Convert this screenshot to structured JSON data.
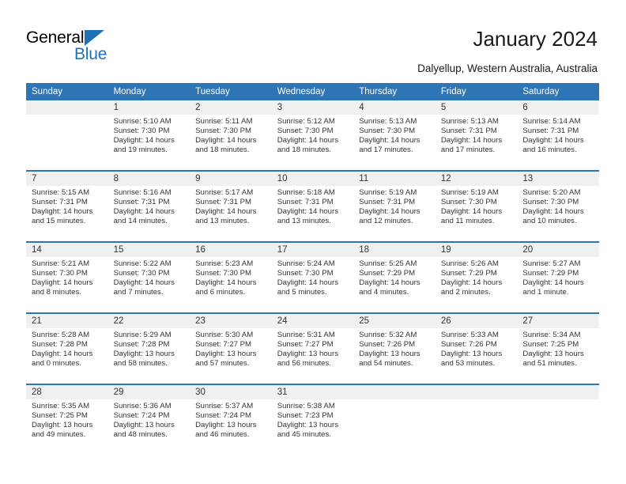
{
  "brand": {
    "name_part1": "General",
    "name_part2": "Blue",
    "triangle_color": "#1f71b8",
    "blue_color": "#1f71b8"
  },
  "header": {
    "title": "January 2024",
    "subtitle": "Dalyellup, Western Australia, Australia",
    "header_bg": "#2e75b6",
    "daynum_bg": "#f0f0f0"
  },
  "weekday_headers": [
    "Sunday",
    "Monday",
    "Tuesday",
    "Wednesday",
    "Thursday",
    "Friday",
    "Saturday"
  ],
  "weeks": [
    [
      {
        "day": "",
        "sunrise": "",
        "sunset": "",
        "daylight_line1": "",
        "daylight_line2": "",
        "empty": true
      },
      {
        "day": "1",
        "sunrise": "Sunrise: 5:10 AM",
        "sunset": "Sunset: 7:30 PM",
        "daylight_line1": "Daylight: 14 hours",
        "daylight_line2": "and 19 minutes.",
        "empty": false
      },
      {
        "day": "2",
        "sunrise": "Sunrise: 5:11 AM",
        "sunset": "Sunset: 7:30 PM",
        "daylight_line1": "Daylight: 14 hours",
        "daylight_line2": "and 18 minutes.",
        "empty": false
      },
      {
        "day": "3",
        "sunrise": "Sunrise: 5:12 AM",
        "sunset": "Sunset: 7:30 PM",
        "daylight_line1": "Daylight: 14 hours",
        "daylight_line2": "and 18 minutes.",
        "empty": false
      },
      {
        "day": "4",
        "sunrise": "Sunrise: 5:13 AM",
        "sunset": "Sunset: 7:30 PM",
        "daylight_line1": "Daylight: 14 hours",
        "daylight_line2": "and 17 minutes.",
        "empty": false
      },
      {
        "day": "5",
        "sunrise": "Sunrise: 5:13 AM",
        "sunset": "Sunset: 7:31 PM",
        "daylight_line1": "Daylight: 14 hours",
        "daylight_line2": "and 17 minutes.",
        "empty": false
      },
      {
        "day": "6",
        "sunrise": "Sunrise: 5:14 AM",
        "sunset": "Sunset: 7:31 PM",
        "daylight_line1": "Daylight: 14 hours",
        "daylight_line2": "and 16 minutes.",
        "empty": false
      }
    ],
    [
      {
        "day": "7",
        "sunrise": "Sunrise: 5:15 AM",
        "sunset": "Sunset: 7:31 PM",
        "daylight_line1": "Daylight: 14 hours",
        "daylight_line2": "and 15 minutes.",
        "empty": false
      },
      {
        "day": "8",
        "sunrise": "Sunrise: 5:16 AM",
        "sunset": "Sunset: 7:31 PM",
        "daylight_line1": "Daylight: 14 hours",
        "daylight_line2": "and 14 minutes.",
        "empty": false
      },
      {
        "day": "9",
        "sunrise": "Sunrise: 5:17 AM",
        "sunset": "Sunset: 7:31 PM",
        "daylight_line1": "Daylight: 14 hours",
        "daylight_line2": "and 13 minutes.",
        "empty": false
      },
      {
        "day": "10",
        "sunrise": "Sunrise: 5:18 AM",
        "sunset": "Sunset: 7:31 PM",
        "daylight_line1": "Daylight: 14 hours",
        "daylight_line2": "and 13 minutes.",
        "empty": false
      },
      {
        "day": "11",
        "sunrise": "Sunrise: 5:19 AM",
        "sunset": "Sunset: 7:31 PM",
        "daylight_line1": "Daylight: 14 hours",
        "daylight_line2": "and 12 minutes.",
        "empty": false
      },
      {
        "day": "12",
        "sunrise": "Sunrise: 5:19 AM",
        "sunset": "Sunset: 7:30 PM",
        "daylight_line1": "Daylight: 14 hours",
        "daylight_line2": "and 11 minutes.",
        "empty": false
      },
      {
        "day": "13",
        "sunrise": "Sunrise: 5:20 AM",
        "sunset": "Sunset: 7:30 PM",
        "daylight_line1": "Daylight: 14 hours",
        "daylight_line2": "and 10 minutes.",
        "empty": false
      }
    ],
    [
      {
        "day": "14",
        "sunrise": "Sunrise: 5:21 AM",
        "sunset": "Sunset: 7:30 PM",
        "daylight_line1": "Daylight: 14 hours",
        "daylight_line2": "and 8 minutes.",
        "empty": false
      },
      {
        "day": "15",
        "sunrise": "Sunrise: 5:22 AM",
        "sunset": "Sunset: 7:30 PM",
        "daylight_line1": "Daylight: 14 hours",
        "daylight_line2": "and 7 minutes.",
        "empty": false
      },
      {
        "day": "16",
        "sunrise": "Sunrise: 5:23 AM",
        "sunset": "Sunset: 7:30 PM",
        "daylight_line1": "Daylight: 14 hours",
        "daylight_line2": "and 6 minutes.",
        "empty": false
      },
      {
        "day": "17",
        "sunrise": "Sunrise: 5:24 AM",
        "sunset": "Sunset: 7:30 PM",
        "daylight_line1": "Daylight: 14 hours",
        "daylight_line2": "and 5 minutes.",
        "empty": false
      },
      {
        "day": "18",
        "sunrise": "Sunrise: 5:25 AM",
        "sunset": "Sunset: 7:29 PM",
        "daylight_line1": "Daylight: 14 hours",
        "daylight_line2": "and 4 minutes.",
        "empty": false
      },
      {
        "day": "19",
        "sunrise": "Sunrise: 5:26 AM",
        "sunset": "Sunset: 7:29 PM",
        "daylight_line1": "Daylight: 14 hours",
        "daylight_line2": "and 2 minutes.",
        "empty": false
      },
      {
        "day": "20",
        "sunrise": "Sunrise: 5:27 AM",
        "sunset": "Sunset: 7:29 PM",
        "daylight_line1": "Daylight: 14 hours",
        "daylight_line2": "and 1 minute.",
        "empty": false
      }
    ],
    [
      {
        "day": "21",
        "sunrise": "Sunrise: 5:28 AM",
        "sunset": "Sunset: 7:28 PM",
        "daylight_line1": "Daylight: 14 hours",
        "daylight_line2": "and 0 minutes.",
        "empty": false
      },
      {
        "day": "22",
        "sunrise": "Sunrise: 5:29 AM",
        "sunset": "Sunset: 7:28 PM",
        "daylight_line1": "Daylight: 13 hours",
        "daylight_line2": "and 58 minutes.",
        "empty": false
      },
      {
        "day": "23",
        "sunrise": "Sunrise: 5:30 AM",
        "sunset": "Sunset: 7:27 PM",
        "daylight_line1": "Daylight: 13 hours",
        "daylight_line2": "and 57 minutes.",
        "empty": false
      },
      {
        "day": "24",
        "sunrise": "Sunrise: 5:31 AM",
        "sunset": "Sunset: 7:27 PM",
        "daylight_line1": "Daylight: 13 hours",
        "daylight_line2": "and 56 minutes.",
        "empty": false
      },
      {
        "day": "25",
        "sunrise": "Sunrise: 5:32 AM",
        "sunset": "Sunset: 7:26 PM",
        "daylight_line1": "Daylight: 13 hours",
        "daylight_line2": "and 54 minutes.",
        "empty": false
      },
      {
        "day": "26",
        "sunrise": "Sunrise: 5:33 AM",
        "sunset": "Sunset: 7:26 PM",
        "daylight_line1": "Daylight: 13 hours",
        "daylight_line2": "and 53 minutes.",
        "empty": false
      },
      {
        "day": "27",
        "sunrise": "Sunrise: 5:34 AM",
        "sunset": "Sunset: 7:25 PM",
        "daylight_line1": "Daylight: 13 hours",
        "daylight_line2": "and 51 minutes.",
        "empty": false
      }
    ],
    [
      {
        "day": "28",
        "sunrise": "Sunrise: 5:35 AM",
        "sunset": "Sunset: 7:25 PM",
        "daylight_line1": "Daylight: 13 hours",
        "daylight_line2": "and 49 minutes.",
        "empty": false
      },
      {
        "day": "29",
        "sunrise": "Sunrise: 5:36 AM",
        "sunset": "Sunset: 7:24 PM",
        "daylight_line1": "Daylight: 13 hours",
        "daylight_line2": "and 48 minutes.",
        "empty": false
      },
      {
        "day": "30",
        "sunrise": "Sunrise: 5:37 AM",
        "sunset": "Sunset: 7:24 PM",
        "daylight_line1": "Daylight: 13 hours",
        "daylight_line2": "and 46 minutes.",
        "empty": false
      },
      {
        "day": "31",
        "sunrise": "Sunrise: 5:38 AM",
        "sunset": "Sunset: 7:23 PM",
        "daylight_line1": "Daylight: 13 hours",
        "daylight_line2": "and 45 minutes.",
        "empty": false
      },
      {
        "day": "",
        "sunrise": "",
        "sunset": "",
        "daylight_line1": "",
        "daylight_line2": "",
        "empty": true
      },
      {
        "day": "",
        "sunrise": "",
        "sunset": "",
        "daylight_line1": "",
        "daylight_line2": "",
        "empty": true
      },
      {
        "day": "",
        "sunrise": "",
        "sunset": "",
        "daylight_line1": "",
        "daylight_line2": "",
        "empty": true
      }
    ]
  ]
}
